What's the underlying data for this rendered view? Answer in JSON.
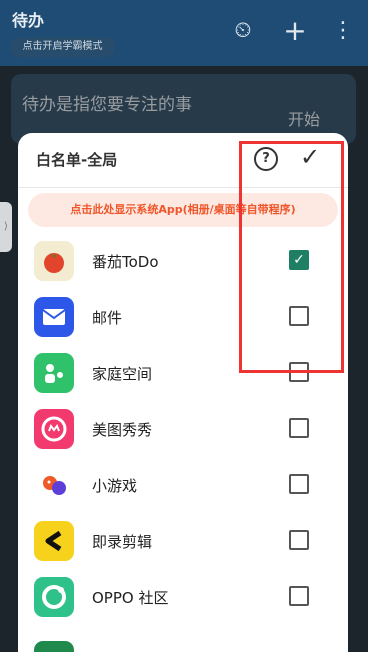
{
  "app": {
    "title": "待办",
    "mode_button": "点击开启学霸模式",
    "top_icons": [
      "timer-icon",
      "add-icon",
      "more-icon"
    ]
  },
  "background": {
    "task_text": "待办是指您要专注的事",
    "start_label": "开始"
  },
  "dialog": {
    "title": "白名单-全局",
    "system_apps_button": "点击此处显示系统App(相册/桌面等自带程序)",
    "apps": [
      {
        "name": "番茄ToDo",
        "checked": true
      },
      {
        "name": "邮件",
        "checked": false
      },
      {
        "name": "家庭空间",
        "checked": false
      },
      {
        "name": "美图秀秀",
        "checked": false
      },
      {
        "name": "小游戏",
        "checked": false
      },
      {
        "name": "即录剪辑",
        "checked": false
      },
      {
        "name": "OPPO 社区",
        "checked": false
      }
    ]
  },
  "colors": {
    "accent_check": "#1f7f63",
    "system_btn_text": "#f0562a",
    "highlight": "#e33333"
  }
}
